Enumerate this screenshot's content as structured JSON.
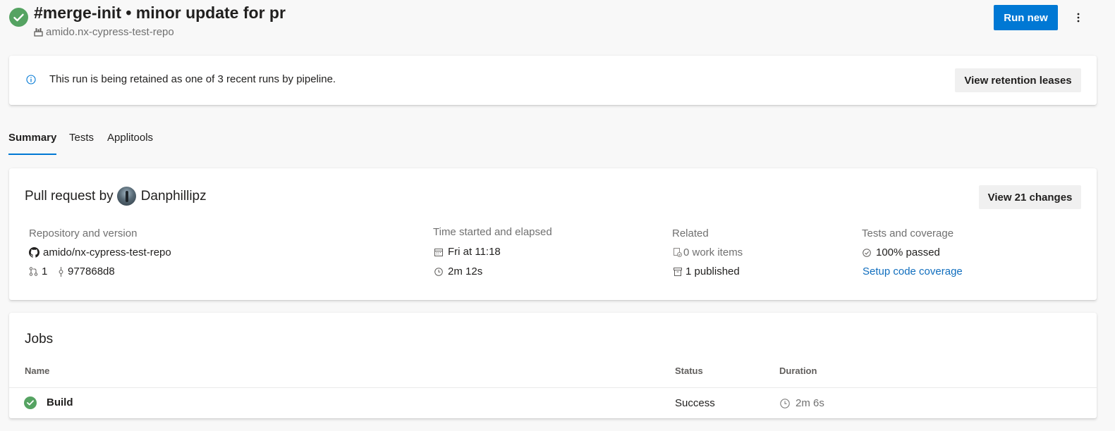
{
  "header": {
    "title": "#merge-init • minor update for pr",
    "repo": "amido.nx-cypress-test-repo",
    "run_new_label": "Run new",
    "status_icon": "success-check-icon",
    "colors": {
      "success": "#55a362",
      "primary": "#0078d4"
    }
  },
  "banner": {
    "message": "This run is being retained as one of 3 recent runs by pipeline.",
    "button_label": "View retention leases"
  },
  "tabs": [
    {
      "label": "Summary",
      "active": true
    },
    {
      "label": "Tests",
      "active": false
    },
    {
      "label": "Applitools",
      "active": false
    }
  ],
  "summary": {
    "pr_prefix": "Pull request by",
    "author": "Danphillipz",
    "view_changes_label": "View 21 changes",
    "repository": {
      "heading": "Repository and version",
      "name": "amido/nx-cypress-test-repo",
      "pr_number": "1",
      "commit": "977868d8"
    },
    "time": {
      "heading": "Time started and elapsed",
      "started": "Fri at 11:18",
      "elapsed": "2m 12s"
    },
    "related": {
      "heading": "Related",
      "work_items": "0 work items",
      "published": "1 published"
    },
    "tests": {
      "heading": "Tests and coverage",
      "passed": "100% passed",
      "coverage_link": "Setup code coverage"
    }
  },
  "jobs": {
    "title": "Jobs",
    "columns": {
      "name": "Name",
      "status": "Status",
      "duration": "Duration"
    },
    "rows": [
      {
        "name": "Build",
        "status": "Success",
        "duration": "2m 6s"
      }
    ]
  }
}
